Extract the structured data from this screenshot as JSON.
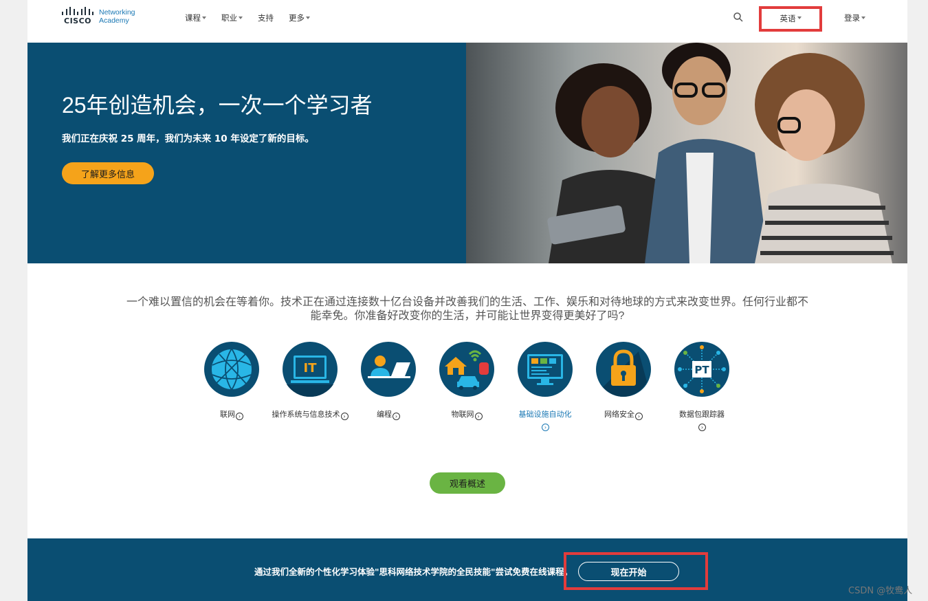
{
  "header": {
    "logo_word": "CISCO",
    "logo_line1": "Networking",
    "logo_line2": "Academy",
    "nav": [
      "课程",
      "职业",
      "支持",
      "更多"
    ],
    "language": "英语",
    "login": "登录"
  },
  "hero": {
    "title": "25年创造机会，一次一个学习者",
    "subtitle": "我们正在庆祝 25 周年，我们为未来 10 年设定了新的目标。",
    "button": "了解更多信息"
  },
  "intro": "一个难以置信的机会在等着你。技术正在通过连接数十亿台设备并改善我们的生活、工作、娱乐和对待地球的方式来改变世界。任何行业都不能幸免。你准备好改变你的生活，并可能让世界变得更美好了吗?",
  "tracks": [
    {
      "label": "联网",
      "icon": "globe-network-icon"
    },
    {
      "label": "操作系统与信息技术",
      "icon": "it-monitor-icon"
    },
    {
      "label": "编程",
      "icon": "programmer-laptop-icon"
    },
    {
      "label": "物联网",
      "icon": "iot-devices-icon"
    },
    {
      "label": "基础设施自动化",
      "icon": "code-monitor-icon"
    },
    {
      "label": "网络安全",
      "icon": "padlock-icon"
    },
    {
      "label": "数据包跟踪器",
      "icon": "packet-tracer-icon"
    }
  ],
  "overview_button": "观看概述",
  "banner": {
    "text": "通过我们全新的个性化学习体验\"思科网络技术学院的全民技能\"尝试免费在线课程。",
    "button": "现在开始"
  },
  "watermark": "CSDN @牧鸯人",
  "colors": {
    "navy": "#0a4e72",
    "orange": "#f5a31a",
    "green": "#6ab443",
    "link_blue": "#1a78b4",
    "highlight_red": "#e23c3c"
  }
}
